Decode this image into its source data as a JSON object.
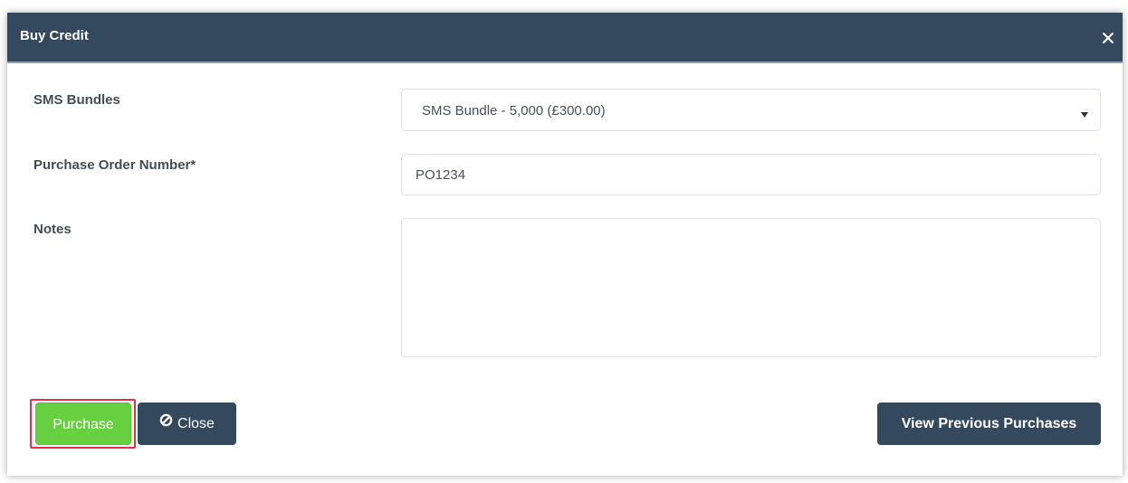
{
  "modal": {
    "title": "Buy Credit"
  },
  "form": {
    "sms_bundles": {
      "label": "SMS Bundles",
      "selected": "SMS Bundle - 5,000 (£300.00)"
    },
    "purchase_order": {
      "label": "Purchase Order Number*",
      "value": "PO1234"
    },
    "notes": {
      "label": "Notes",
      "value": ""
    }
  },
  "buttons": {
    "purchase": "Purchase",
    "close": "Close",
    "view_previous": "View Previous Purchases"
  },
  "colors": {
    "header": "#34485e",
    "primary": "#34485e",
    "success": "#66d041",
    "highlight": "#e0334a"
  },
  "icons": {
    "close_modal": "close-icon",
    "close_button": "ban-icon",
    "select_arrow": "caret-down-icon"
  }
}
